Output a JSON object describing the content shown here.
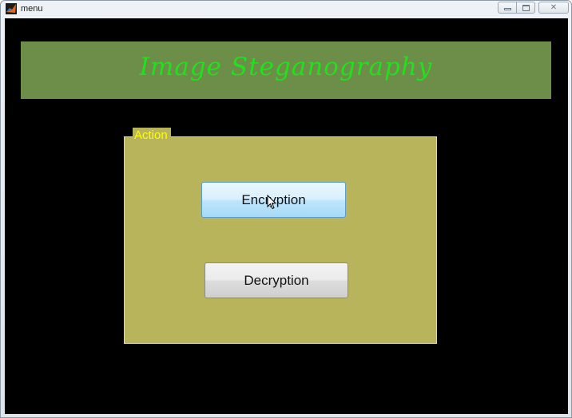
{
  "window": {
    "title": "menu"
  },
  "banner": {
    "title": "Image Steganography"
  },
  "panel": {
    "legend": "Action",
    "buttons": {
      "encrypt_label": "Encryption",
      "decrypt_label": "Decryption"
    }
  },
  "titlebar_controls": {
    "close_glyph": "✕"
  },
  "colors": {
    "client_background": "#000000",
    "banner_background": "#6c8e48",
    "banner_text": "#22e01e",
    "panel_background": "#b8b45c",
    "legend_text": "#ffff00",
    "encrypt_hover": "#bee6fd"
  },
  "icons": {
    "app_icon": "matlab-icon",
    "minimize": "minimize-icon",
    "maximize": "maximize-icon",
    "close": "close-icon",
    "cursor": "mouse-pointer-icon"
  }
}
